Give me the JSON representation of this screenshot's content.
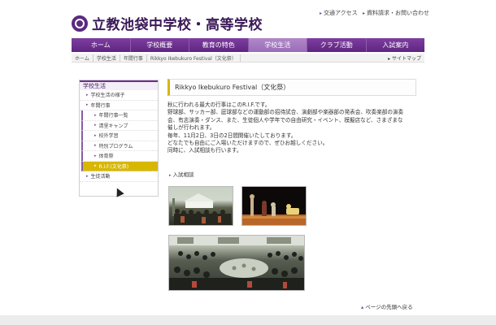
{
  "header": {
    "school_name": "立教池袋中学校・高等学校",
    "utility_links": [
      {
        "label": "交通アクセス"
      },
      {
        "label": "資料請求・お問い合わせ"
      }
    ]
  },
  "global_nav": [
    {
      "label": "ホーム"
    },
    {
      "label": "学校概要"
    },
    {
      "label": "教育の特色"
    },
    {
      "label": "学校生活",
      "active": true
    },
    {
      "label": "クラブ活動"
    },
    {
      "label": "入試案内"
    }
  ],
  "breadcrumb": [
    "ホーム",
    "学校生活",
    "年間行事",
    "Rikkyo Ikebukuro Festival（文化祭）"
  ],
  "sitemap_label": "サイトマップ",
  "sidebar": {
    "heading": "学校生活",
    "items": [
      {
        "label": "学校生活の様子",
        "level": 1
      },
      {
        "label": "年間行事",
        "level": 1
      },
      {
        "label": "年間行事一覧",
        "level": 2
      },
      {
        "label": "清里キャンプ",
        "level": 2
      },
      {
        "label": "校外学習",
        "level": 2
      },
      {
        "label": "特別プログラム",
        "level": 2
      },
      {
        "label": "体育祭",
        "level": 2
      },
      {
        "label": "R.I.F.(文化祭)",
        "level": 2,
        "active": true
      },
      {
        "label": "生徒活動",
        "level": 1
      }
    ]
  },
  "main": {
    "title": "Rikkyo Ikebukuro Festival（文化祭）",
    "paragraphs": [
      "秋に行われる最大の行事はこのR.I.F.です。",
      "野球部、サッカー部、庭球部などの運動部の招待試合、演劇部や楽器部の発表会、吹奏楽部の演奏",
      "会、有志演奏・ダンス、また、生徒個人や学年での自由研究・イベント、模擬店など、さまざまな",
      "催しが行われます。",
      "毎年、11月2日、3日の2日間開催いたしております。",
      "どなたでも自由にご入場いただけますので、ぜひお越しください。",
      "同時に、入試相談も行います。"
    ],
    "link_label": "入試相談",
    "page_top_label": "ページの先頭へ戻る"
  },
  "colors": {
    "brand_purple": "#6e2f8f",
    "active_yellow": "#d7b700"
  },
  "icons": [
    "school-crest-icon",
    "arrow-bullet-icon",
    "mouse-cursor-icon"
  ]
}
